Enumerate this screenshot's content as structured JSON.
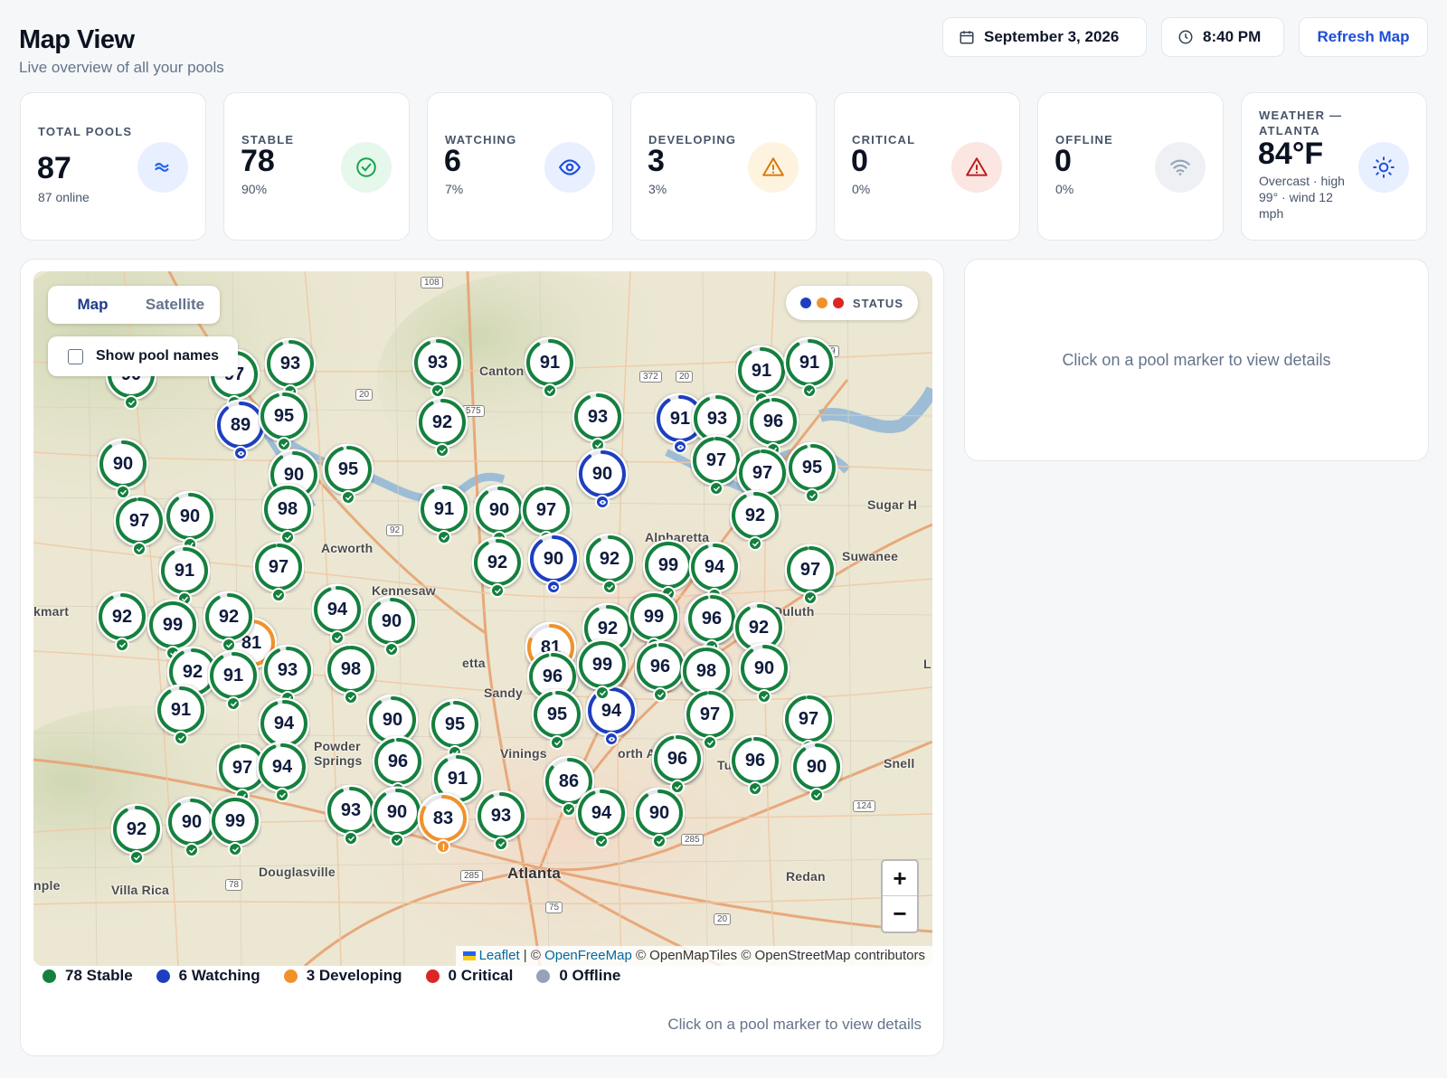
{
  "header": {
    "title": "Map View",
    "subtitle": "Live overview of all your pools",
    "date": "September 3, 2026",
    "time": "8:40 PM",
    "refresh_label": "Refresh Map"
  },
  "cards": [
    {
      "label": "TOTAL POOLS",
      "value": "87",
      "sub": "87 online",
      "icon": "waves-icon",
      "color": "#2563eb",
      "bg": "#e8efff"
    },
    {
      "label": "STABLE",
      "value": "78",
      "sub": "90%",
      "icon": "check-circle-icon",
      "color": "#16a34a",
      "bg": "#e6f7ec"
    },
    {
      "label": "WATCHING",
      "value": "6",
      "sub": "7%",
      "icon": "eye-icon",
      "color": "#1d4ed8",
      "bg": "#e8efff"
    },
    {
      "label": "DEVELOPING",
      "value": "3",
      "sub": "3%",
      "icon": "warning-icon",
      "color": "#d97706",
      "bg": "#fdf3df"
    },
    {
      "label": "CRITICAL",
      "value": "0",
      "sub": "0%",
      "icon": "alert-triangle-icon",
      "color": "#b91c1c",
      "bg": "#fbe6e1"
    },
    {
      "label": "OFFLINE",
      "value": "0",
      "sub": "0%",
      "icon": "wifi-icon",
      "color": "#94a3b8",
      "bg": "#eef0f3"
    },
    {
      "label": "WEATHER — ATLANTA",
      "value": "84°F",
      "sub": "Overcast · high 99° · wind 12 mph",
      "icon": "sun-icon",
      "color": "#1d4ed8",
      "bg": "#e8efff"
    }
  ],
  "map": {
    "tabs": [
      "Map",
      "Satellite"
    ],
    "show_names_label": "Show pool names",
    "status_label": "STATUS",
    "zoom_in": "+",
    "zoom_out": "−",
    "attribution": {
      "leaflet": "Leaflet",
      "sep": " | © ",
      "openfreemap": "OpenFreeMap",
      "rest": " © OpenMapTiles © OpenStreetMap contributors"
    },
    "place_labels": [
      "Canton",
      "Alpharetta",
      "Sugar H",
      "Suwanee",
      "Acworth",
      "Kennesaw",
      "Duluth",
      "kmart",
      "etta",
      "Sandy",
      "Powder Springs",
      "Vinings",
      "orth A",
      "Snell",
      "Douglasville",
      "Atlanta",
      "Villa Rica",
      "Redan",
      "nple",
      "L",
      "Tu"
    ],
    "shields": [
      "108",
      "372",
      "20",
      "269",
      "20",
      "575",
      "92",
      "124",
      "285",
      "78",
      "75",
      "20",
      "285",
      "20",
      "285"
    ]
  },
  "status_colors": {
    "stable": "#15803d",
    "watching": "#1d3fbf",
    "developing": "#f0922b",
    "critical": "#dc2626",
    "offline": "#94a3b8"
  },
  "pools": [
    {
      "v": "90",
      "s": "stable"
    },
    {
      "v": "97",
      "s": "stable"
    },
    {
      "v": "93",
      "s": "stable"
    },
    {
      "v": "89",
      "s": "watching"
    },
    {
      "v": "95",
      "s": "stable"
    },
    {
      "v": "90",
      "s": "stable"
    },
    {
      "v": "90",
      "s": "stable"
    },
    {
      "v": "95",
      "s": "stable"
    },
    {
      "v": "98",
      "s": "stable"
    },
    {
      "v": "97",
      "s": "stable"
    },
    {
      "v": "90",
      "s": "stable"
    },
    {
      "v": "91",
      "s": "stable"
    },
    {
      "v": "97",
      "s": "stable"
    },
    {
      "v": "92",
      "s": "stable"
    },
    {
      "v": "99",
      "s": "stable"
    },
    {
      "v": "81",
      "s": "developing"
    },
    {
      "v": "92",
      "s": "stable"
    },
    {
      "v": "94",
      "s": "stable"
    },
    {
      "v": "90",
      "s": "stable"
    },
    {
      "v": "92",
      "s": "stable"
    },
    {
      "v": "91",
      "s": "stable"
    },
    {
      "v": "93",
      "s": "stable"
    },
    {
      "v": "98",
      "s": "stable"
    },
    {
      "v": "91",
      "s": "stable"
    },
    {
      "v": "94",
      "s": "stable"
    },
    {
      "v": "97",
      "s": "stable"
    },
    {
      "v": "94",
      "s": "stable"
    },
    {
      "v": "92",
      "s": "stable"
    },
    {
      "v": "90",
      "s": "stable"
    },
    {
      "v": "99",
      "s": "stable"
    },
    {
      "v": "93",
      "s": "stable"
    },
    {
      "v": "92",
      "s": "stable"
    },
    {
      "v": "91",
      "s": "stable"
    },
    {
      "v": "93",
      "s": "stable"
    },
    {
      "v": "91",
      "s": "stable"
    },
    {
      "v": "90",
      "s": "stable"
    },
    {
      "v": "97",
      "s": "stable"
    },
    {
      "v": "92",
      "s": "stable"
    },
    {
      "v": "90",
      "s": "watching"
    },
    {
      "v": "92",
      "s": "stable"
    },
    {
      "v": "99",
      "s": "stable"
    },
    {
      "v": "99",
      "s": "stable"
    },
    {
      "v": "90",
      "s": "stable"
    },
    {
      "v": "95",
      "s": "stable"
    },
    {
      "v": "96",
      "s": "stable"
    },
    {
      "v": "91",
      "s": "stable"
    },
    {
      "v": "90",
      "s": "stable"
    },
    {
      "v": "93",
      "s": "stable"
    },
    {
      "v": "83",
      "s": "developing"
    },
    {
      "v": "81",
      "s": "developing"
    },
    {
      "v": "96",
      "s": "stable"
    },
    {
      "v": "99",
      "s": "stable"
    },
    {
      "v": "95",
      "s": "stable"
    },
    {
      "v": "94",
      "s": "watching"
    },
    {
      "v": "92",
      "s": "stable"
    },
    {
      "v": "96",
      "s": "stable"
    },
    {
      "v": "98",
      "s": "stable"
    },
    {
      "v": "86",
      "s": "stable"
    },
    {
      "v": "94",
      "s": "stable"
    },
    {
      "v": "90",
      "s": "stable"
    },
    {
      "v": "96",
      "s": "stable"
    },
    {
      "v": "93",
      "s": "stable"
    },
    {
      "v": "90",
      "s": "watching"
    },
    {
      "v": "91",
      "s": "watching"
    },
    {
      "v": "93",
      "s": "stable"
    },
    {
      "v": "97",
      "s": "stable"
    },
    {
      "v": "94",
      "s": "stable"
    },
    {
      "v": "91",
      "s": "stable"
    },
    {
      "v": "96",
      "s": "stable"
    },
    {
      "v": "91",
      "s": "stable"
    },
    {
      "v": "97",
      "s": "stable"
    },
    {
      "v": "95",
      "s": "stable"
    },
    {
      "v": "92",
      "s": "stable"
    },
    {
      "v": "99",
      "s": "stable"
    },
    {
      "v": "94",
      "s": "stable"
    },
    {
      "v": "96",
      "s": "stable"
    },
    {
      "v": "99",
      "s": "stable"
    },
    {
      "v": "96",
      "s": "stable"
    },
    {
      "v": "92",
      "s": "stable"
    },
    {
      "v": "90",
      "s": "stable"
    },
    {
      "v": "98",
      "s": "stable"
    },
    {
      "v": "97",
      "s": "stable"
    },
    {
      "v": "96",
      "s": "stable"
    },
    {
      "v": "97",
      "s": "stable"
    },
    {
      "v": "97",
      "s": "stable"
    },
    {
      "v": "90",
      "s": "stable"
    },
    {
      "v": "96",
      "s": "stable"
    }
  ],
  "legend": [
    {
      "label": "78 Stable",
      "color": "#15803d"
    },
    {
      "label": "6 Watching",
      "color": "#1d3fbf"
    },
    {
      "label": "3 Developing",
      "color": "#f0922b"
    },
    {
      "label": "0 Critical",
      "color": "#dc2626"
    },
    {
      "label": "0 Offline",
      "color": "#94a3b8"
    }
  ],
  "hint": "Click on a pool marker to view details",
  "detail_placeholder": "Click on a pool marker to view details"
}
